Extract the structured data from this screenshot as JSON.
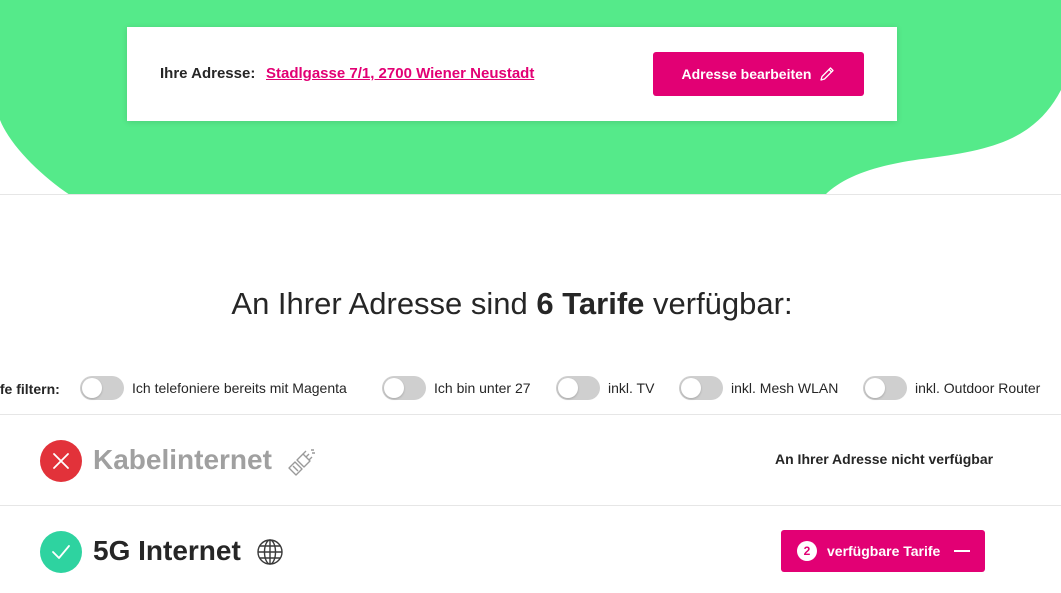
{
  "colors": {
    "brand_magenta": "#e20074",
    "hero_green": "#55ea8a",
    "status_red": "#e2323a",
    "status_green": "#2ed3a0"
  },
  "address": {
    "label": "Ihre Adresse:",
    "value": "Stadlgasse 7/1, 2700 Wiener Neustadt",
    "edit_button": "Adresse bearbeiten"
  },
  "headline": {
    "prefix": "An Ihrer Adresse sind ",
    "count": "6 Tarife",
    "suffix": " verfügbar:"
  },
  "filters": {
    "label": "ife filtern:",
    "toggles": [
      {
        "label": "Ich telefoniere bereits mit Magenta",
        "on": false
      },
      {
        "label": "Ich bin unter 27",
        "on": false
      },
      {
        "label": "inkl. TV",
        "on": false
      },
      {
        "label": "inkl. Mesh WLAN",
        "on": false
      },
      {
        "label": "inkl. Outdoor Router",
        "on": false
      }
    ]
  },
  "products": [
    {
      "name": "Kabelinternet",
      "available": false,
      "status_text": "An Ihrer Adresse nicht verfügbar",
      "icon": "cable-plug-icon"
    },
    {
      "name": "5G Internet",
      "available": true,
      "tariff_count": "2",
      "tariff_button": "verfügbare Tarife",
      "icon": "globe-icon"
    }
  ]
}
